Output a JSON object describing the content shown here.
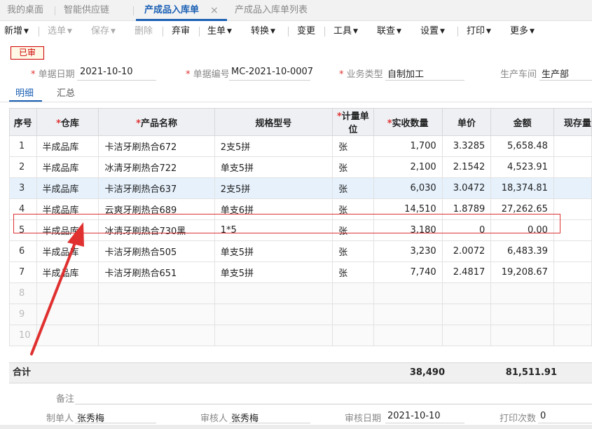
{
  "tabs": [
    {
      "label": "我的桌面"
    },
    {
      "label": "智能供应链"
    },
    {
      "label": "产成品入库单",
      "active": true
    },
    {
      "label": "产成品入库单列表"
    }
  ],
  "tab_close": "×",
  "toolbar": {
    "new": "新增",
    "select": "选单",
    "save": "保存",
    "delete": "删除",
    "abandon": "弃审",
    "generate": "生单",
    "convert": "转换",
    "change": "变更",
    "tools": "工具",
    "link": "联查",
    "settings": "设置",
    "print": "打印",
    "more": "更多",
    "caret": "▼"
  },
  "status_badge": "已审",
  "form": {
    "date_label": "单据日期",
    "date_value": "2021-10-10",
    "code_label": "单据编号",
    "code_value": "MC-2021-10-0007",
    "type_label": "业务类型",
    "type_value": "自制加工",
    "workshop_label": "生产车间",
    "workshop_value": "生产部",
    "required_mark": "*"
  },
  "subtabs": {
    "detail": "明细",
    "summary": "汇总"
  },
  "grid": {
    "headers": {
      "idx": "序号",
      "warehouse": "仓库",
      "product": "产品名称",
      "spec": "规格型号",
      "unit": "计量单位",
      "qty": "实收数量",
      "price": "单价",
      "amount": "金额",
      "stock": "现存量"
    },
    "rows": [
      {
        "idx": "1",
        "warehouse": "半成品库",
        "product": "卡洁牙刷热合672",
        "spec": "2支5拼",
        "unit": "张",
        "qty": "1,700",
        "price": "3.3285",
        "amount": "5,658.48"
      },
      {
        "idx": "2",
        "warehouse": "半成品库",
        "product": "冰清牙刷热合722",
        "spec": "单支5拼",
        "unit": "张",
        "qty": "2,100",
        "price": "2.1542",
        "amount": "4,523.91"
      },
      {
        "idx": "3",
        "warehouse": "半成品库",
        "product": "卡洁牙刷热合637",
        "spec": "2支5拼",
        "unit": "张",
        "qty": "6,030",
        "price": "3.0472",
        "amount": "18,374.81"
      },
      {
        "idx": "4",
        "warehouse": "半成品库",
        "product": "云爽牙刷热合689",
        "spec": "单支6拼",
        "unit": "张",
        "qty": "14,510",
        "price": "1.8789",
        "amount": "27,262.65"
      },
      {
        "idx": "5",
        "warehouse": "半成品库",
        "product": "冰清牙刷热合730黑",
        "spec": "1*5",
        "unit": "张",
        "qty": "3,180",
        "price": "0",
        "amount": "0.00"
      },
      {
        "idx": "6",
        "warehouse": "半成品库",
        "product": "卡洁牙刷热合505",
        "spec": "单支5拼",
        "unit": "张",
        "qty": "3,230",
        "price": "2.0072",
        "amount": "6,483.39"
      },
      {
        "idx": "7",
        "warehouse": "半成品库",
        "product": "卡洁牙刷热合651",
        "spec": "单支5拼",
        "unit": "张",
        "qty": "7,740",
        "price": "2.4817",
        "amount": "19,208.67"
      }
    ],
    "empty_rows": [
      "8",
      "9",
      "10"
    ]
  },
  "totals": {
    "label": "合计",
    "qty": "38,490",
    "amount": "81,511.91"
  },
  "footer": {
    "remark_label": "备注",
    "maker_label": "制单人",
    "maker_value": "张秀梅",
    "auditor_label": "审核人",
    "auditor_value": "张秀梅",
    "audit_date_label": "审核日期",
    "audit_date_value": "2021-10-10",
    "print_count_label": "打印次数",
    "print_count_value": "0"
  },
  "colors": {
    "accent": "#1a5fb4",
    "annotation": "#e03030",
    "selected_row": "#e6f1fc"
  }
}
